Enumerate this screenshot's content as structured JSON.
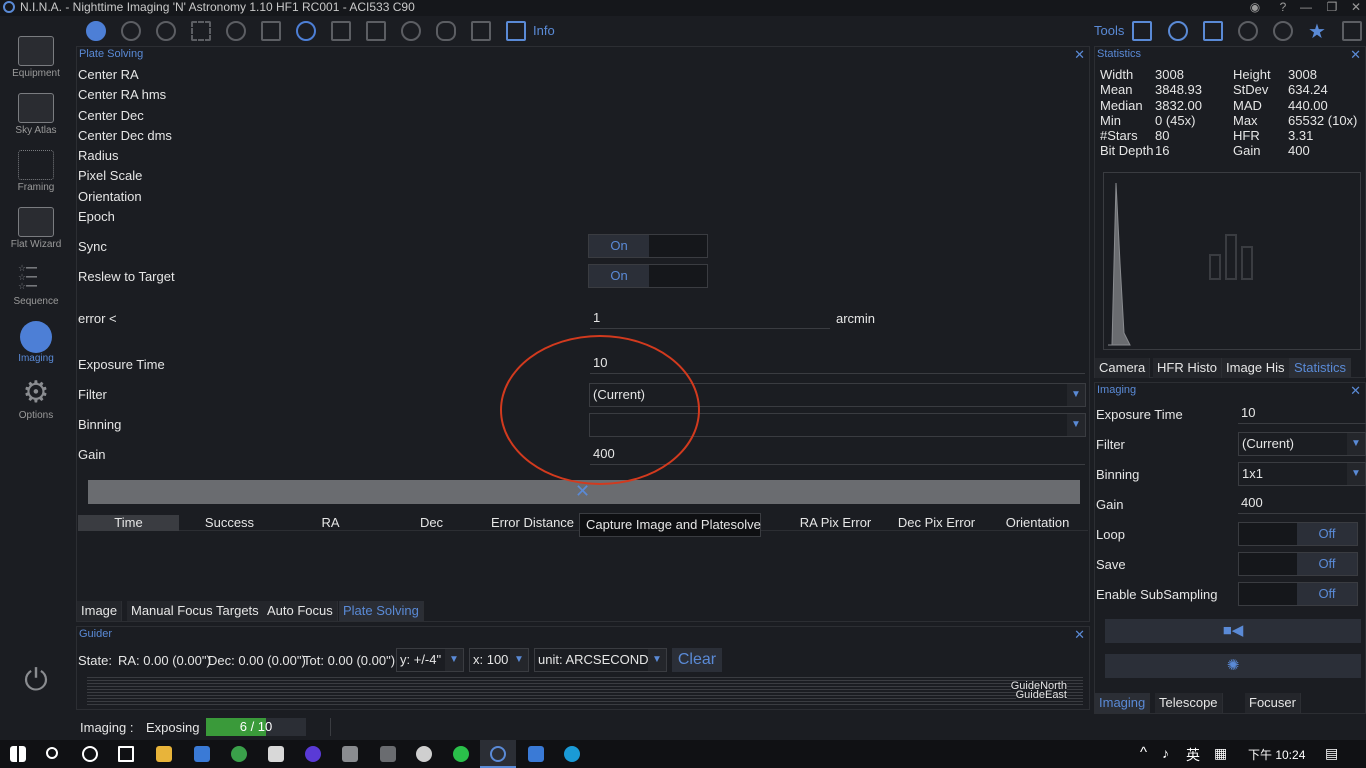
{
  "window": {
    "title": "N.I.N.A. - Nighttime Imaging 'N' Astronomy 1.10 HF1 RC001  -  ACI533 C90"
  },
  "sidebar": {
    "items": [
      {
        "label": "Equipment"
      },
      {
        "label": "Sky Atlas"
      },
      {
        "label": "Framing"
      },
      {
        "label": "Flat Wizard"
      },
      {
        "label": "Sequence"
      },
      {
        "label": "Imaging"
      },
      {
        "label": "Options"
      }
    ]
  },
  "toolbar": {
    "info_label": "Info",
    "tools_label": "Tools"
  },
  "plate": {
    "title": "Plate Solving",
    "rows": [
      "Center RA",
      "Center RA hms",
      "Center Dec",
      "Center Dec dms",
      "Radius",
      "Pixel Scale",
      "Orientation",
      "Epoch"
    ],
    "sync_label": "Sync",
    "sync_value": "On",
    "reslew_label": "Reslew to Target",
    "reslew_value": "On",
    "error_label": "error <",
    "error_value": "1",
    "error_unit": "arcmin",
    "exposure_label": "Exposure Time",
    "exposure_value": "10",
    "filter_label": "Filter",
    "filter_value": "(Current)",
    "binning_label": "Binning",
    "binning_value": "",
    "gain_label": "Gain",
    "gain_value": "400",
    "tooltip": "Capture Image and Platesolve",
    "columns": [
      "Time",
      "Success",
      "RA",
      "Dec",
      "Error Distance",
      "",
      "RA Pix Error",
      "Dec Pix Error",
      "Orientation"
    ],
    "tabs": [
      "Image",
      "Manual Focus Targets",
      "Auto Focus",
      "Plate Solving"
    ]
  },
  "guider": {
    "title": "Guider",
    "state": "State:",
    "ra": "RA: 0.00 (0.00\")",
    "dec": "Dec: 0.00 (0.00\")",
    "tot": "Tot: 0.00 (0.00\")",
    "y_select": "y: +/-4\"",
    "x_select": "x: 100",
    "unit_select": "unit: ARCSECONDS",
    "clear": "Clear",
    "guide_north": "GuideNorth",
    "guide_east": "GuideEast"
  },
  "stats": {
    "title": "Statistics",
    "left": [
      [
        "Width",
        "3008"
      ],
      [
        "Mean",
        "3848.93"
      ],
      [
        "Median",
        "3832.00"
      ],
      [
        "Min",
        "0 (45x)"
      ],
      [
        "#Stars",
        "80"
      ],
      [
        "Bit Depth",
        "16"
      ]
    ],
    "right": [
      [
        "Height",
        "3008"
      ],
      [
        "StDev",
        "634.24"
      ],
      [
        "MAD",
        "440.00"
      ],
      [
        "Max",
        "65532 (10x)"
      ],
      [
        "HFR",
        "3.31"
      ],
      [
        "Gain",
        "400"
      ]
    ],
    "tabs": [
      "Camera",
      "HFR Histo",
      "Image His",
      "Statistics"
    ]
  },
  "imaging": {
    "title": "Imaging",
    "exposure_label": "Exposure Time",
    "exposure_value": "10",
    "filter_label": "Filter",
    "filter_value": "(Current)",
    "binning_label": "Binning",
    "binning_value": "1x1",
    "gain_label": "Gain",
    "gain_value": "400",
    "loop_label": "Loop",
    "loop_value": "Off",
    "save_label": "Save",
    "save_value": "Off",
    "subsampling_label": "Enable SubSampling",
    "subsampling_value": "Off",
    "tabs": [
      "Imaging",
      "Telescope",
      "Focuser"
    ]
  },
  "status": {
    "label": "Imaging :",
    "state": "Exposing",
    "progress_text": "6 / 10",
    "progress": 0.6
  },
  "taskbar": {
    "lang": "英",
    "time": "下午 10:24"
  },
  "colors": {
    "accent": "#5a8ad6",
    "progress": "#3a9a3a",
    "annotation": "#d23a1e"
  }
}
